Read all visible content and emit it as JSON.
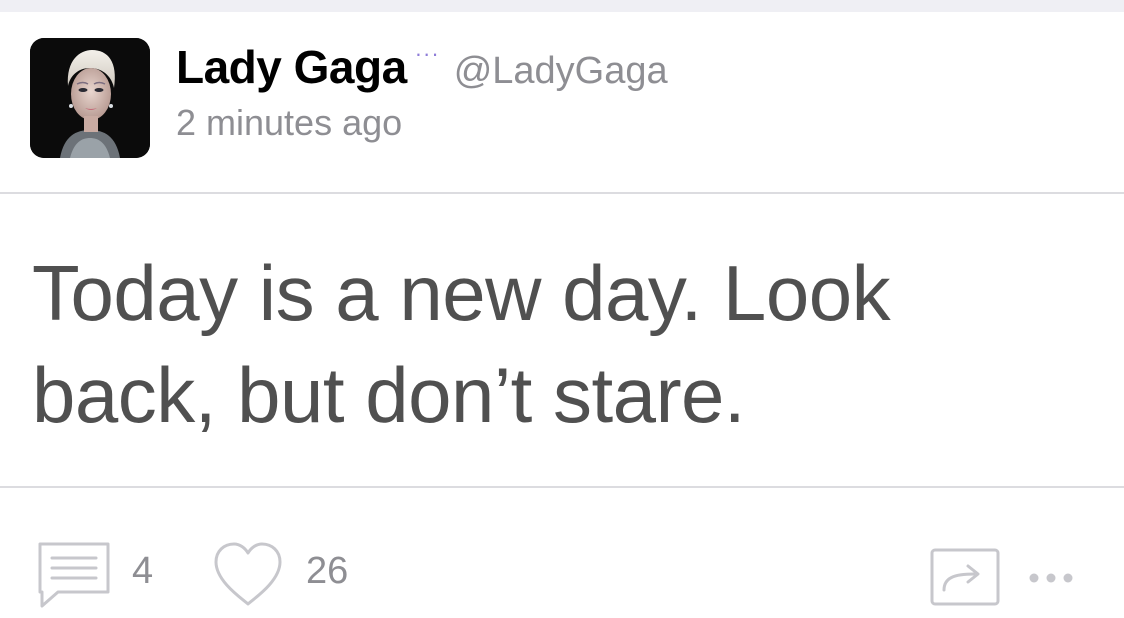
{
  "author": {
    "display_name": "Lady Gaga",
    "handle": "@LadyGaga",
    "badge": "···",
    "avatar_icon": "avatar-portrait"
  },
  "post": {
    "timestamp": "2 minutes ago",
    "text": "Today is a new day. Look back, but don’t stare."
  },
  "actions": {
    "comment_count": "4",
    "like_count": "26",
    "comment_icon": "comment-icon",
    "like_icon": "heart-icon",
    "share_icon": "share-icon",
    "more_icon": "more-icon"
  },
  "colors": {
    "name": "#000000",
    "secondary": "#8e8e93",
    "body": "#505050",
    "badge": "#8e7cd8",
    "icon_stroke": "#c7c7cc",
    "divider": "#dcdce0",
    "background_strip": "#efeff4"
  }
}
